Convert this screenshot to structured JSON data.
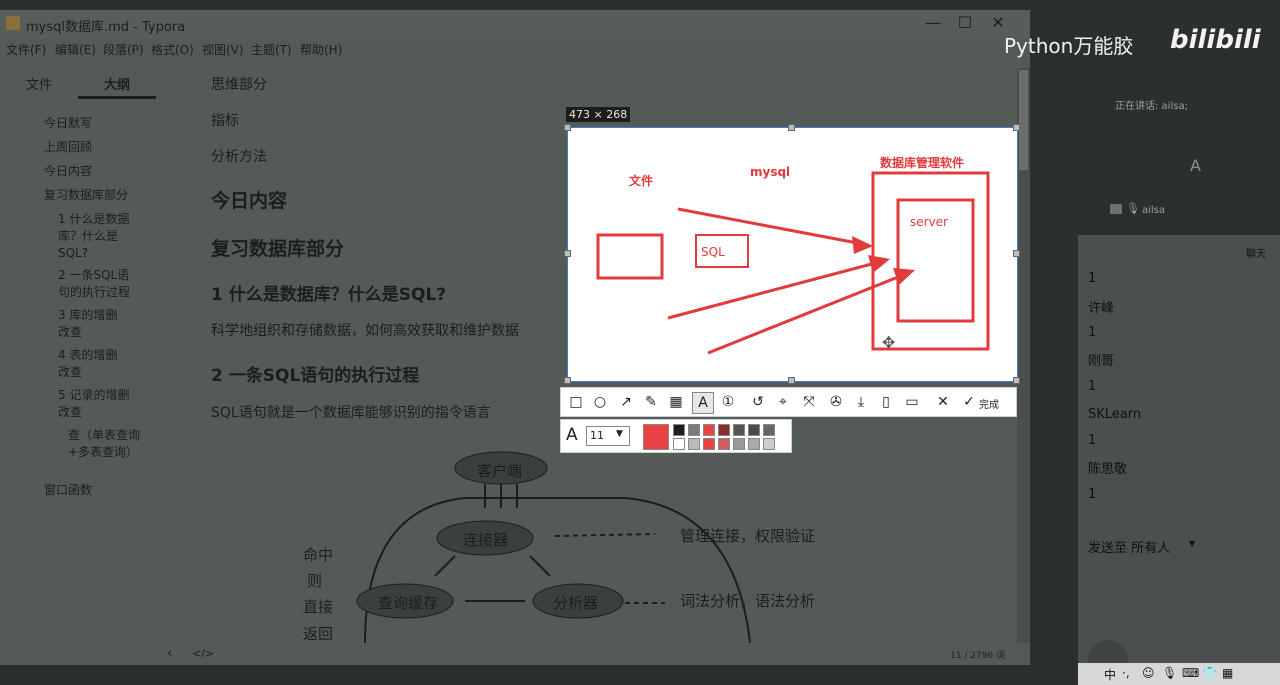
{
  "window": {
    "title": "mysql数据库.md - Typora"
  },
  "menu": [
    "文件(F)",
    "编辑(E)",
    "段落(P)",
    "格式(O)",
    "视图(V)",
    "主题(T)",
    "帮助(H)"
  ],
  "sidebar": {
    "tabs": [
      "文件",
      "大纲"
    ],
    "outline": [
      "今日默写",
      "上周回顾",
      "今日内容",
      "复习数据库部分",
      "1 什么是数据库？什么是SQL?",
      "2 一条SQL语句的执行过程",
      "3 库的增删改查",
      "4 表的增删改查",
      "5 记录的增删改查",
      "查（单表查询+多表查询）",
      "窗口函数"
    ]
  },
  "editor": {
    "lines": [
      "思维部分",
      "指标",
      "分析方法"
    ],
    "h_today": "今日内容",
    "h_review": "复习数据库部分",
    "h3_1": "1 什么是数据库？什么是SQL?",
    "p1": "科学地组织和存储数据，如何高效获取和维护数据",
    "h3_2": "2 一条SQL语句的执行过程",
    "p2": "SQL语句就是一个数据库能够识别的指令语言",
    "sketch": {
      "client": "客户端",
      "connector": "连接器",
      "connector_note": "管理连接，权限验证",
      "query_cache": "查询缓存",
      "analyzer": "分析器",
      "analyzer_note": "词法分析，语法分析",
      "side_note": [
        "命中",
        "则",
        "直接",
        "返回"
      ]
    }
  },
  "statusbar": {
    "words": "11 / 2796 词"
  },
  "capture": {
    "size_label": "473 × 268",
    "label_file": "文件",
    "label_mysql": "mysql",
    "label_dbms": "数据库管理软件",
    "label_server": "server",
    "label_sql": "SQL",
    "color": "#e23b3b"
  },
  "toolbar": {
    "done_label": "完成",
    "tools": [
      "rect-icon",
      "circle-icon",
      "arrow-icon",
      "pen-icon",
      "mosaic-icon",
      "text-icon",
      "number-icon",
      "undo-icon",
      "pin-icon",
      "ocr-icon",
      "translate-icon",
      "save-icon",
      "long-capture-icon",
      "bookmark-icon"
    ]
  },
  "fontbar": {
    "font_size": "11",
    "accent": "#e84444"
  },
  "watermark": {
    "text": "Python万能胶",
    "logo": "bilibili"
  },
  "right": {
    "speaking": "正在讲话: ailsa;",
    "font_icon": "A",
    "user": "ailsa",
    "chat_title": "聊天",
    "chat": [
      "1",
      "许峰",
      "1",
      "刚哥",
      "1",
      "SKLearn",
      "1",
      "陈思敬",
      "1"
    ],
    "send_to": "发送至 所有人"
  }
}
